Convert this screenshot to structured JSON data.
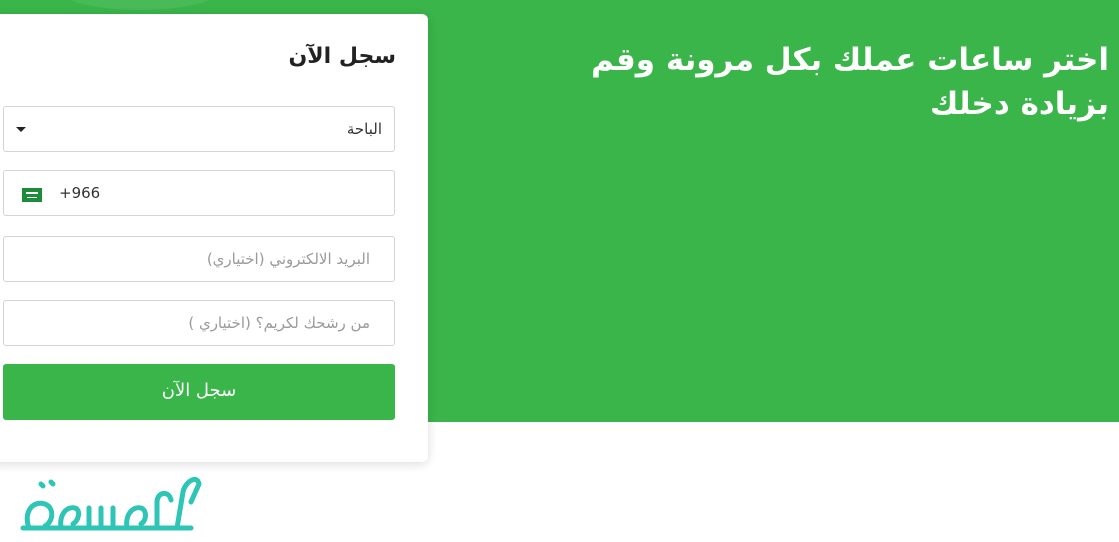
{
  "hero": {
    "headline": "اختر ساعات عملك بكل مرونة وقم بزيادة دخلك"
  },
  "form": {
    "title": "سجل الآن",
    "region_select": {
      "selected": "الباحة"
    },
    "phone": {
      "country_code": "+966",
      "flag_icon": "saudi-arabia-flag-icon"
    },
    "email": {
      "placeholder": "البريد الالكتروني (اختياري)"
    },
    "referral": {
      "placeholder": "من رشحك لكريم؟ (اختياري )"
    },
    "submit_label": "سجل الآن"
  },
  "watermark": {
    "logo_text": "موسوعة"
  },
  "colors": {
    "brand_green": "#39b54a",
    "logo_teal": "#2ec4b6"
  }
}
